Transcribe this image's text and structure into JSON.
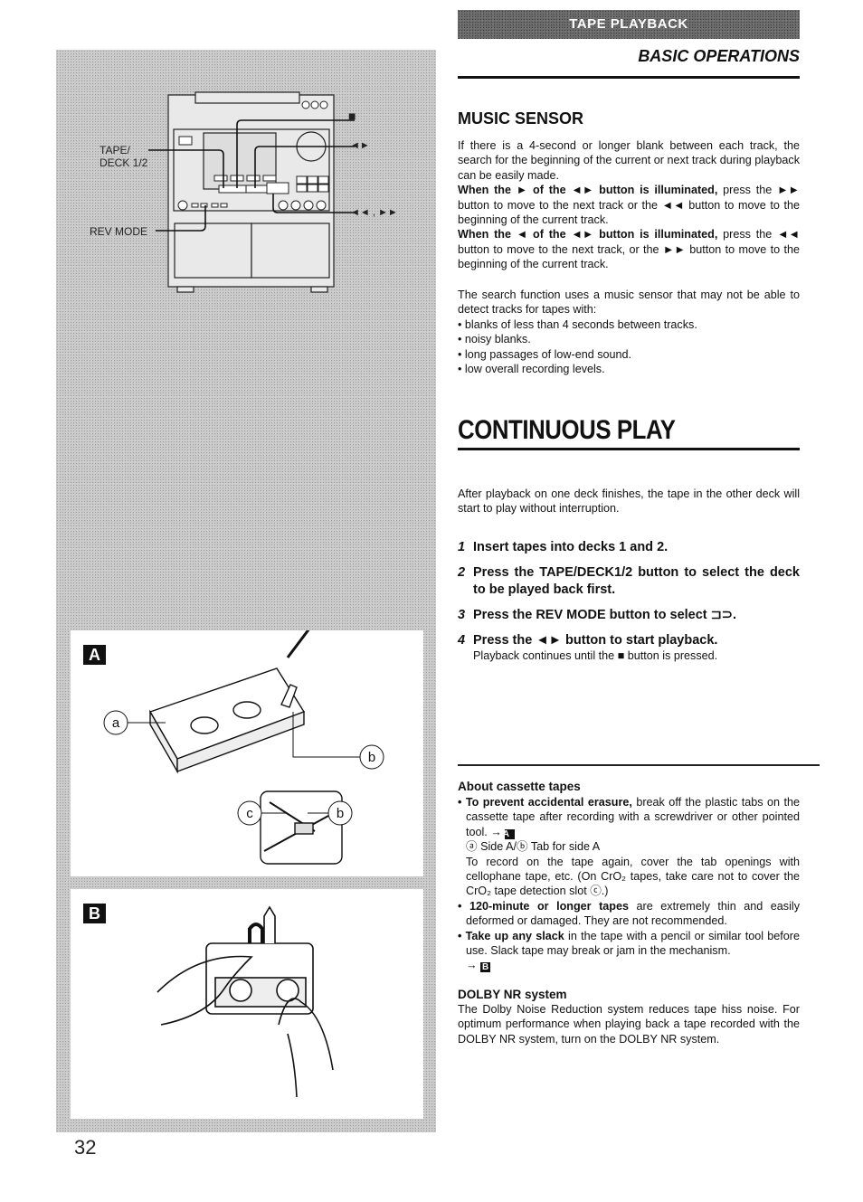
{
  "header": {
    "section_bar": "TAPE PLAYBACK",
    "subheader": "BASIC OPERATIONS"
  },
  "device_figure": {
    "labels": {
      "tape_deck": "TAPE/\nDECK 1/2",
      "tape_deck_line1": "TAPE/",
      "tape_deck_line2": "DECK 1/2",
      "rev_mode": "REV MODE",
      "stop": "■",
      "play": "◄►",
      "rew_ff": "◄◄ , ►►"
    }
  },
  "figure_a": {
    "badge": "A",
    "callouts": [
      "a",
      "b",
      "c",
      "b"
    ]
  },
  "figure_b": {
    "badge": "B"
  },
  "page_number": "32",
  "music_sensor": {
    "title": "MUSIC SENSOR",
    "intro": "If there is a 4-second or longer blank between each track, the search for the beginning of the current or next track during playback can be easily made.",
    "case1_bold": "When the ► of the ◄► button is illuminated,",
    "case1_text": " press the ►► button to move to the next track or the ◄◄ button to move to the beginning of the current track.",
    "case2_bold": "When the ◄ of the ◄► button is illuminated,",
    "case2_text": " press the ◄◄ button to move to the next track, or the ►► button to move to the beginning of the current track.",
    "limitation_intro": "The search function uses a music sensor that may not be able to detect tracks for tapes with:",
    "limitations": [
      "• blanks of less than 4 seconds between tracks.",
      "• noisy blanks.",
      "• long passages of low-end sound.",
      "• low overall recording levels."
    ]
  },
  "continuous_play": {
    "title": "CONTINUOUS PLAY",
    "intro": "After playback on one deck finishes, the tape in the other deck will start to play without interruption.",
    "steps": [
      {
        "num": "1",
        "text": "Insert tapes into decks 1 and 2."
      },
      {
        "num": "2",
        "text": "Press the TAPE/DECK1/2 button to select the deck to be played back first."
      },
      {
        "num": "3",
        "text": "Press the REV MODE button to select ⊐⊃."
      },
      {
        "num": "4",
        "text": "Press the ◄► button to start playback."
      }
    ],
    "step4_note": "Playback continues until the ■ button is pressed."
  },
  "about_tapes": {
    "title": "About cassette tapes",
    "item1_bold": "• To prevent accidental erasure,",
    "item1_text": " break off the plastic tabs on the cassette tape after recording with a screwdriver or other pointed tool. →",
    "item1_ref": "A",
    "item1_legend": "ⓐ Side A/ⓑ Tab for side A",
    "item1_more": "To record on the tape again, cover the tab openings with cellophane tape, etc. (On CrO₂ tapes, take care not to cover the CrO₂ tape detection slot ⓒ.)",
    "item2_bold": "• 120-minute or longer tapes",
    "item2_text": " are extremely thin and easily deformed or damaged. They are not recommended.",
    "item3_bold": "• Take up any slack",
    "item3_text": " in the tape with a pencil or similar tool before use. Slack tape may break or jam in the mechanism.",
    "item3_arrow": "→",
    "item3_ref": "B"
  },
  "dolby": {
    "title": "DOLBY NR system",
    "text": "The Dolby Noise Reduction system reduces tape hiss noise. For optimum performance when playing back a tape recorded with the DOLBY NR system, turn on the DOLBY NR system."
  }
}
